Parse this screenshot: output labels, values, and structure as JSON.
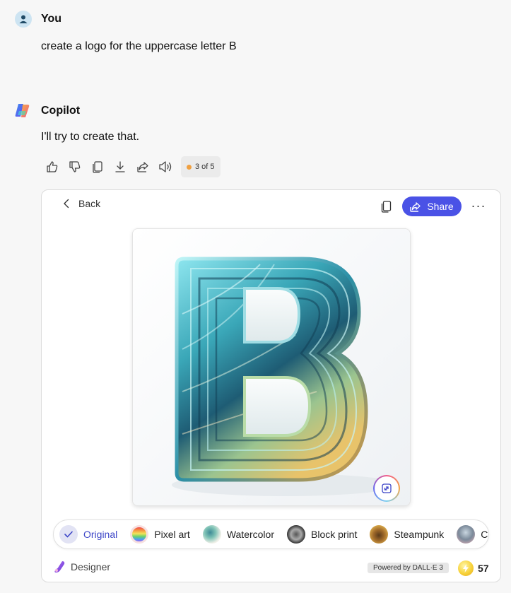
{
  "user": {
    "name": "You",
    "message": "create a logo for the uppercase letter B"
  },
  "copilot": {
    "name": "Copilot",
    "message": "I'll try to create that."
  },
  "actions": {
    "items": [
      "thumbs-up-icon",
      "thumbs-down-icon",
      "copy-icon",
      "download-icon",
      "share-icon",
      "read-aloud-icon"
    ],
    "pager": "3 of 5"
  },
  "card": {
    "back_label": "Back",
    "share_label": "Share",
    "more_label": "···",
    "styles": [
      {
        "label": "Original",
        "selected": true
      },
      {
        "label": "Pixel art",
        "selected": false
      },
      {
        "label": "Watercolor",
        "selected": false
      },
      {
        "label": "Block print",
        "selected": false
      },
      {
        "label": "Steampunk",
        "selected": false
      },
      {
        "label": "Cla",
        "selected": false
      }
    ],
    "designer_label": "Designer",
    "powered_label": "Powered by DALL·E 3",
    "boosts": "57"
  },
  "colors": {
    "accent": "#4a52e6",
    "selected_style": "#3d46c8",
    "pager_dot": "#f0a040"
  }
}
